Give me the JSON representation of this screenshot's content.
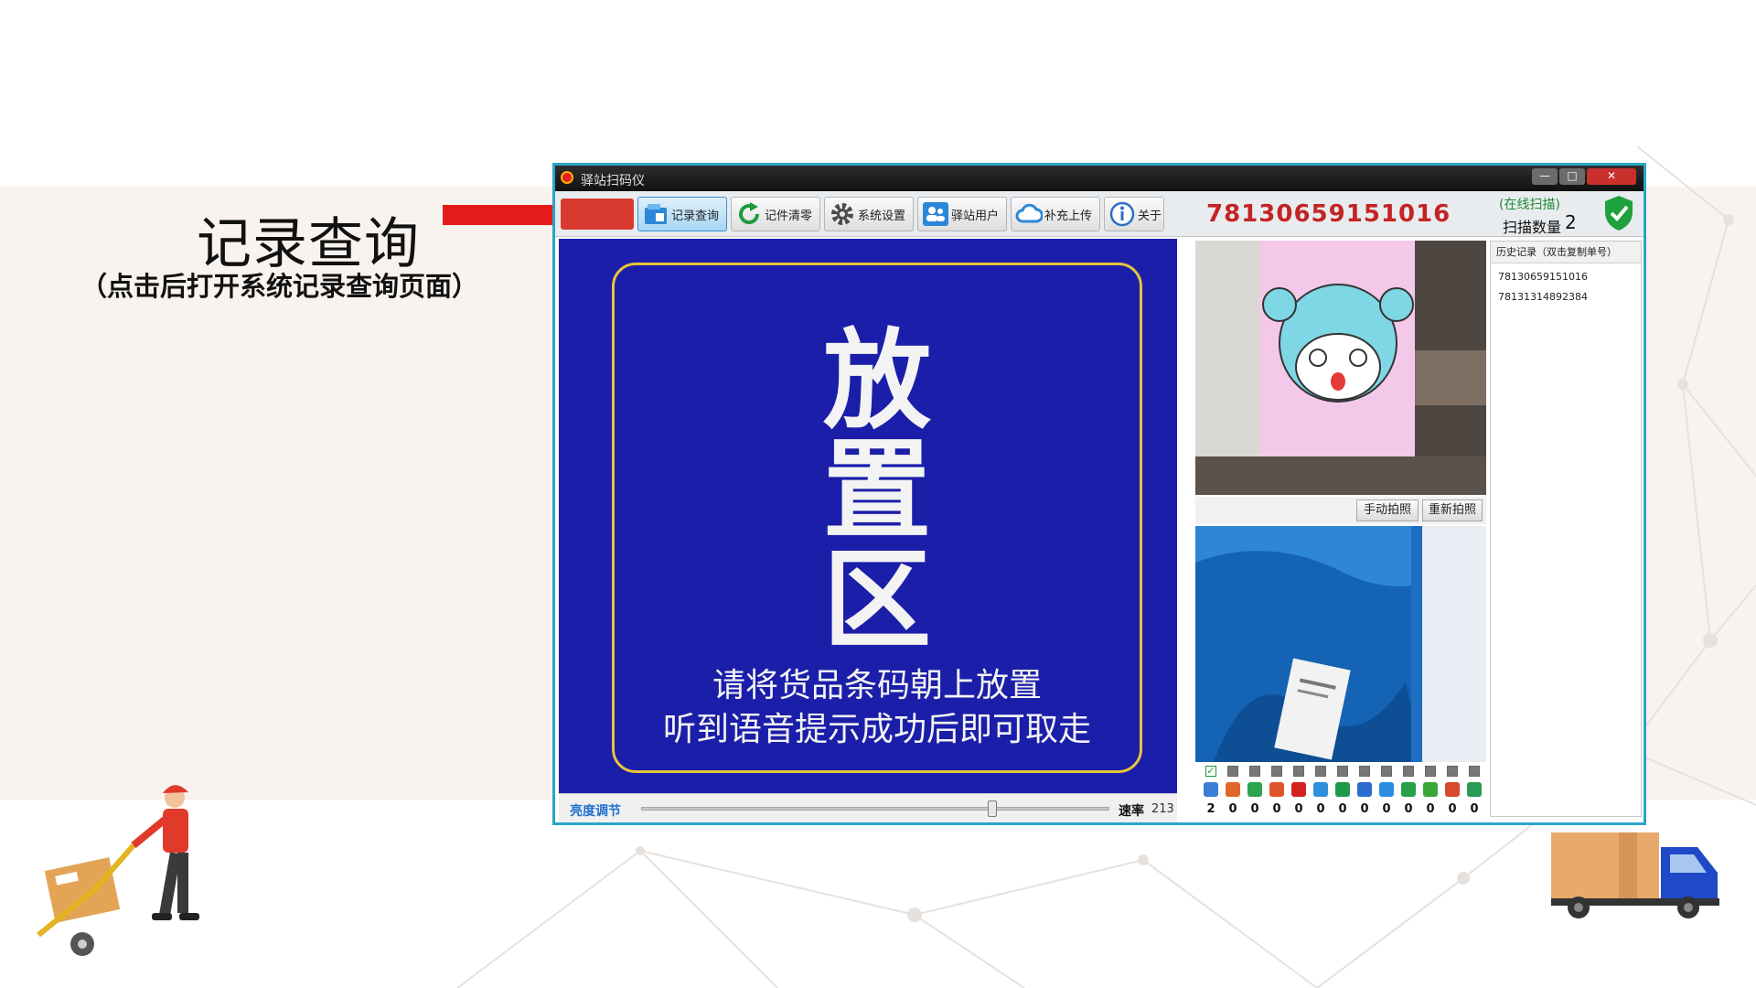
{
  "annotation": {
    "title": "记录查询",
    "subtitle": "（点击后打开系统记录查询页面）"
  },
  "window": {
    "title": "驿站扫码仪",
    "controls": {
      "minimize": "—",
      "maximize": "□",
      "close": "✕"
    }
  },
  "toolbar": {
    "buttons": [
      {
        "label": "记录查询",
        "icon": "record-query-icon",
        "active": true
      },
      {
        "label": "记件清零",
        "icon": "reset-icon"
      },
      {
        "label": "系统设置",
        "icon": "gear-icon"
      },
      {
        "label": "驿站用户",
        "icon": "users-icon"
      },
      {
        "label": "补充上传",
        "icon": "cloud-upload-icon"
      },
      {
        "label": "关于",
        "icon": "info-icon"
      }
    ],
    "current_barcode": "78130659151016",
    "online_status": "(在线扫描)",
    "scan_count_label": "扫描数量",
    "scan_count": "2"
  },
  "main_view": {
    "sign_chars": [
      "放",
      "置",
      "区"
    ],
    "instructions": [
      "请将货品条码朝上放置",
      "听到语音提示成功后即可取走"
    ]
  },
  "camera_buttons": {
    "manual": "手动拍照",
    "retake": "重新拍照"
  },
  "history": {
    "header": "历史记录（双击复制单号）",
    "items": [
      "78130659151016",
      "78131314892384"
    ]
  },
  "statusbar": {
    "brightness_label": "亮度调节",
    "brightness_level": 0.75,
    "rate_label": "速率",
    "rate_value": "213"
  },
  "carriers": [
    {
      "count": "2",
      "checked": true,
      "color": "#3b7ed6"
    },
    {
      "count": "0",
      "checked": false,
      "color": "#e0672c"
    },
    {
      "count": "0",
      "checked": false,
      "color": "#2ea44f"
    },
    {
      "count": "0",
      "checked": false,
      "color": "#e0542c"
    },
    {
      "count": "0",
      "checked": false,
      "color": "#d32222"
    },
    {
      "count": "0",
      "checked": false,
      "color": "#2f8fd8"
    },
    {
      "count": "0",
      "checked": false,
      "color": "#1e9a4a"
    },
    {
      "count": "0",
      "checked": false,
      "color": "#2d6bd0"
    },
    {
      "count": "0",
      "checked": false,
      "color": "#2b8ee0"
    },
    {
      "count": "0",
      "checked": false,
      "color": "#27a04a"
    },
    {
      "count": "0",
      "checked": false,
      "color": "#3aa637"
    },
    {
      "count": "0",
      "checked": false,
      "color": "#d84a2a"
    },
    {
      "count": "0",
      "checked": false,
      "color": "#2a9a55"
    }
  ],
  "colors": {
    "barcode": "#c32424",
    "sign_background": "#1b1ea9",
    "sign_border": "#e7c43a",
    "arrow": "#e31b1b",
    "window_border": "#2aa5c8"
  }
}
